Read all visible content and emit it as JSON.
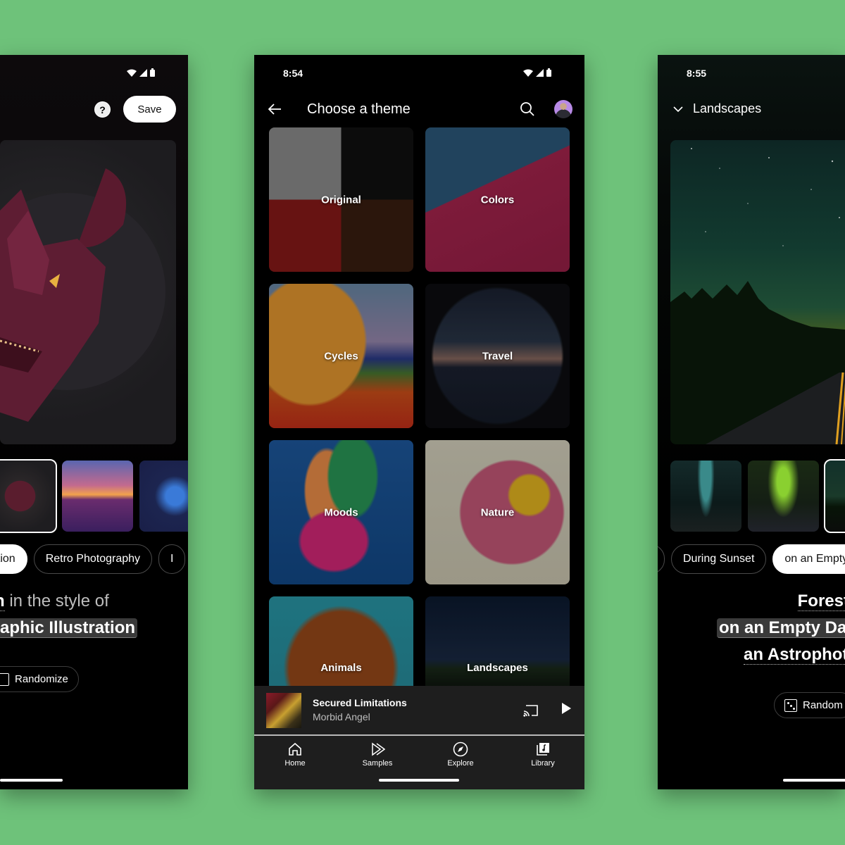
{
  "background_color": "#6ec27a",
  "left_screen": {
    "status": {
      "icons": [
        "wifi-icon",
        "signal-icon",
        "battery-icon"
      ]
    },
    "header": {
      "help_icon": "?",
      "save_label": "Save"
    },
    "hero_image": "dragon-head-illustration",
    "thumbnails": [
      {
        "name": "dragon-head",
        "selected": true
      },
      {
        "name": "dragon-sunset",
        "selected": false
      },
      {
        "name": "crystal-dragon",
        "selected": false
      }
    ],
    "chips": [
      {
        "label": "ation",
        "active": true
      },
      {
        "label": "Retro Photography",
        "active": false
      },
      {
        "label": "I",
        "active": false
      }
    ],
    "prompt": {
      "line1_bold": "n",
      "line1_light": "in the style of",
      "line2_highlight": "aphic Illustration"
    },
    "randomize_label": "Randomize"
  },
  "center_screen": {
    "status": {
      "time": "8:54",
      "icons": [
        "wifi-icon",
        "signal-icon",
        "battery-icon"
      ]
    },
    "header": {
      "title": "Choose a theme"
    },
    "themes": [
      {
        "label": "Original"
      },
      {
        "label": "Colors"
      },
      {
        "label": "Cycles"
      },
      {
        "label": "Travel"
      },
      {
        "label": "Moods"
      },
      {
        "label": "Nature"
      },
      {
        "label": "Animals"
      },
      {
        "label": "Landscapes"
      }
    ],
    "mini_player": {
      "title": "Secured Limitations",
      "artist": "Morbid Angel"
    },
    "bottom_nav": [
      {
        "label": "Home",
        "icon": "home-icon"
      },
      {
        "label": "Samples",
        "icon": "samples-icon"
      },
      {
        "label": "Explore",
        "icon": "compass-icon"
      },
      {
        "label": "Library",
        "icon": "library-icon"
      }
    ]
  },
  "right_screen": {
    "status": {
      "time": "8:55"
    },
    "header": {
      "title": "Landscapes"
    },
    "hero_image": "night-road-forest-stars",
    "thumbnails": [
      {
        "name": "forest-road-teal",
        "selected": false
      },
      {
        "name": "forest-road-green",
        "selected": false
      },
      {
        "name": "night-road",
        "selected": true
      }
    ],
    "chips": [
      {
        "label": "",
        "active": false
      },
      {
        "label": "During Sunset",
        "active": false
      },
      {
        "label": "on an Empty",
        "active": true
      }
    ],
    "prompt": {
      "line1": "Forest",
      "line2_highlight": "on an Empty Dar",
      "line3": "an Astrophot"
    },
    "randomize_label": "Random"
  }
}
